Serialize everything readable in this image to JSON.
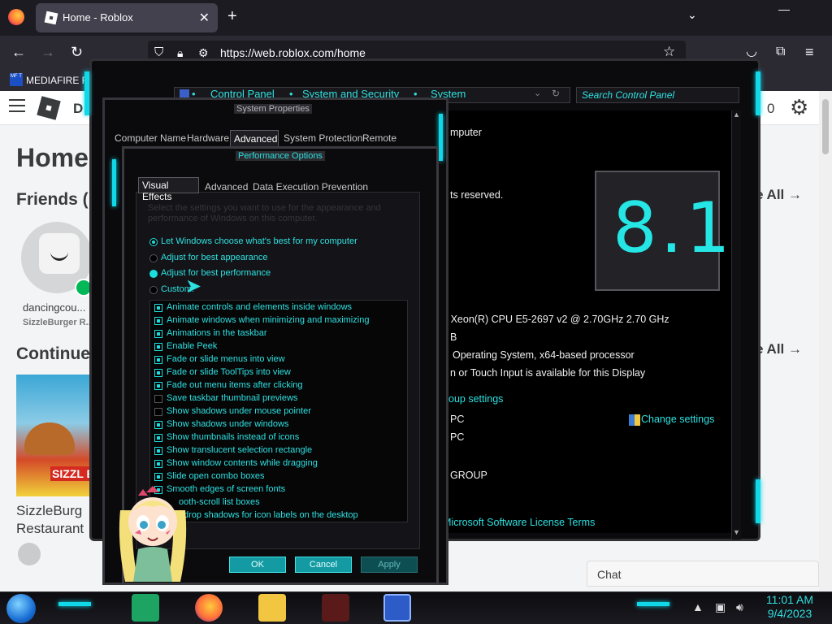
{
  "browser": {
    "tab_title": "Home - Roblox",
    "tab_close": "✕",
    "new_tab": "+",
    "url": "https://web.roblox.com/home",
    "bookmark_label": "MEDIAFIRE RO",
    "bookmark_icon_text": "MF T"
  },
  "roblox": {
    "brand_partial": "D",
    "robux_count": "0",
    "home_title": "Home",
    "friends_title": "Friends (",
    "see_all_1": "e All →",
    "see_all_2": "e All →",
    "friend_name": "dancingcou...",
    "friend_game": "SizzleBurger R...",
    "continue_title": "Continue",
    "game_title_1": "SizzleBurg",
    "game_title_2": "Restaurant",
    "game_logo_text": "SIZZL BURG",
    "chat_label": "Chat"
  },
  "control_panel": {
    "breadcrumb": [
      "Control Panel",
      "System and Security",
      "System"
    ],
    "search_placeholder": "Search Control Panel",
    "texts": {
      "computer": "mputer",
      "rights": "ts reserved.",
      "cpu": "8) Xeon(R) CPU E5-2697 v2 @ 2.70GHz   2.70 GHz",
      "ram": "B",
      "os_type": "Operating System, x64-based processor",
      "pen": "n or Touch Input is available for this Display",
      "workgroup_settings": "oup settings",
      "pc1": "PC",
      "pc2": "PC",
      "workgroup": "GROUP",
      "license": "Microsoft Software License Terms",
      "change_settings": "Change settings"
    },
    "logo_text": "8.1",
    "accent_color": "#2ee0e0"
  },
  "system_properties": {
    "title": "System Properties",
    "tabs": [
      "Computer Name",
      "Hardware",
      "Advanced",
      "System Protection",
      "Remote"
    ],
    "active_tab": "Advanced"
  },
  "performance_options": {
    "title": "Performance Options",
    "tabs": [
      "Visual Effects",
      "Advanced",
      "Data Execution Prevention"
    ],
    "active_tab": "Visual Effects",
    "description": "Select the settings you want to use for the appearance and performance of Windows on this computer.",
    "radios": [
      {
        "label": "Let Windows choose what's best for my computer",
        "state": "selected"
      },
      {
        "label": "Adjust for best appearance",
        "state": "off"
      },
      {
        "label": "Adjust for best performance",
        "state": "filled"
      },
      {
        "label": "Custom:",
        "state": "off"
      }
    ],
    "options": [
      {
        "label": "Animate controls and elements inside windows",
        "checked": true
      },
      {
        "label": "Animate windows when minimizing and maximizing",
        "checked": true
      },
      {
        "label": "Animations in the taskbar",
        "checked": true
      },
      {
        "label": "Enable Peek",
        "checked": true
      },
      {
        "label": "Fade or slide menus into view",
        "checked": true
      },
      {
        "label": "Fade or slide ToolTips into view",
        "checked": true
      },
      {
        "label": "Fade out menu items after clicking",
        "checked": true
      },
      {
        "label": "Save taskbar thumbnail previews",
        "checked": false
      },
      {
        "label": "Show shadows under mouse pointer",
        "checked": false
      },
      {
        "label": "Show shadows under windows",
        "checked": true
      },
      {
        "label": "Show thumbnails instead of icons",
        "checked": true
      },
      {
        "label": "Show translucent selection rectangle",
        "checked": true
      },
      {
        "label": "Show window contents while dragging",
        "checked": true
      },
      {
        "label": "Slide open combo boxes",
        "checked": true
      },
      {
        "label": "Smooth edges of screen fonts",
        "checked": true
      },
      {
        "label": "ooth-scroll list boxes",
        "checked": true
      },
      {
        "label": "drop shadows for icon labels on the desktop",
        "checked": true
      }
    ],
    "buttons": {
      "ok": "OK",
      "cancel": "Cancel",
      "apply": "Apply"
    }
  },
  "taskbar": {
    "time": "11:01 AM",
    "date": "9/4/2023"
  }
}
